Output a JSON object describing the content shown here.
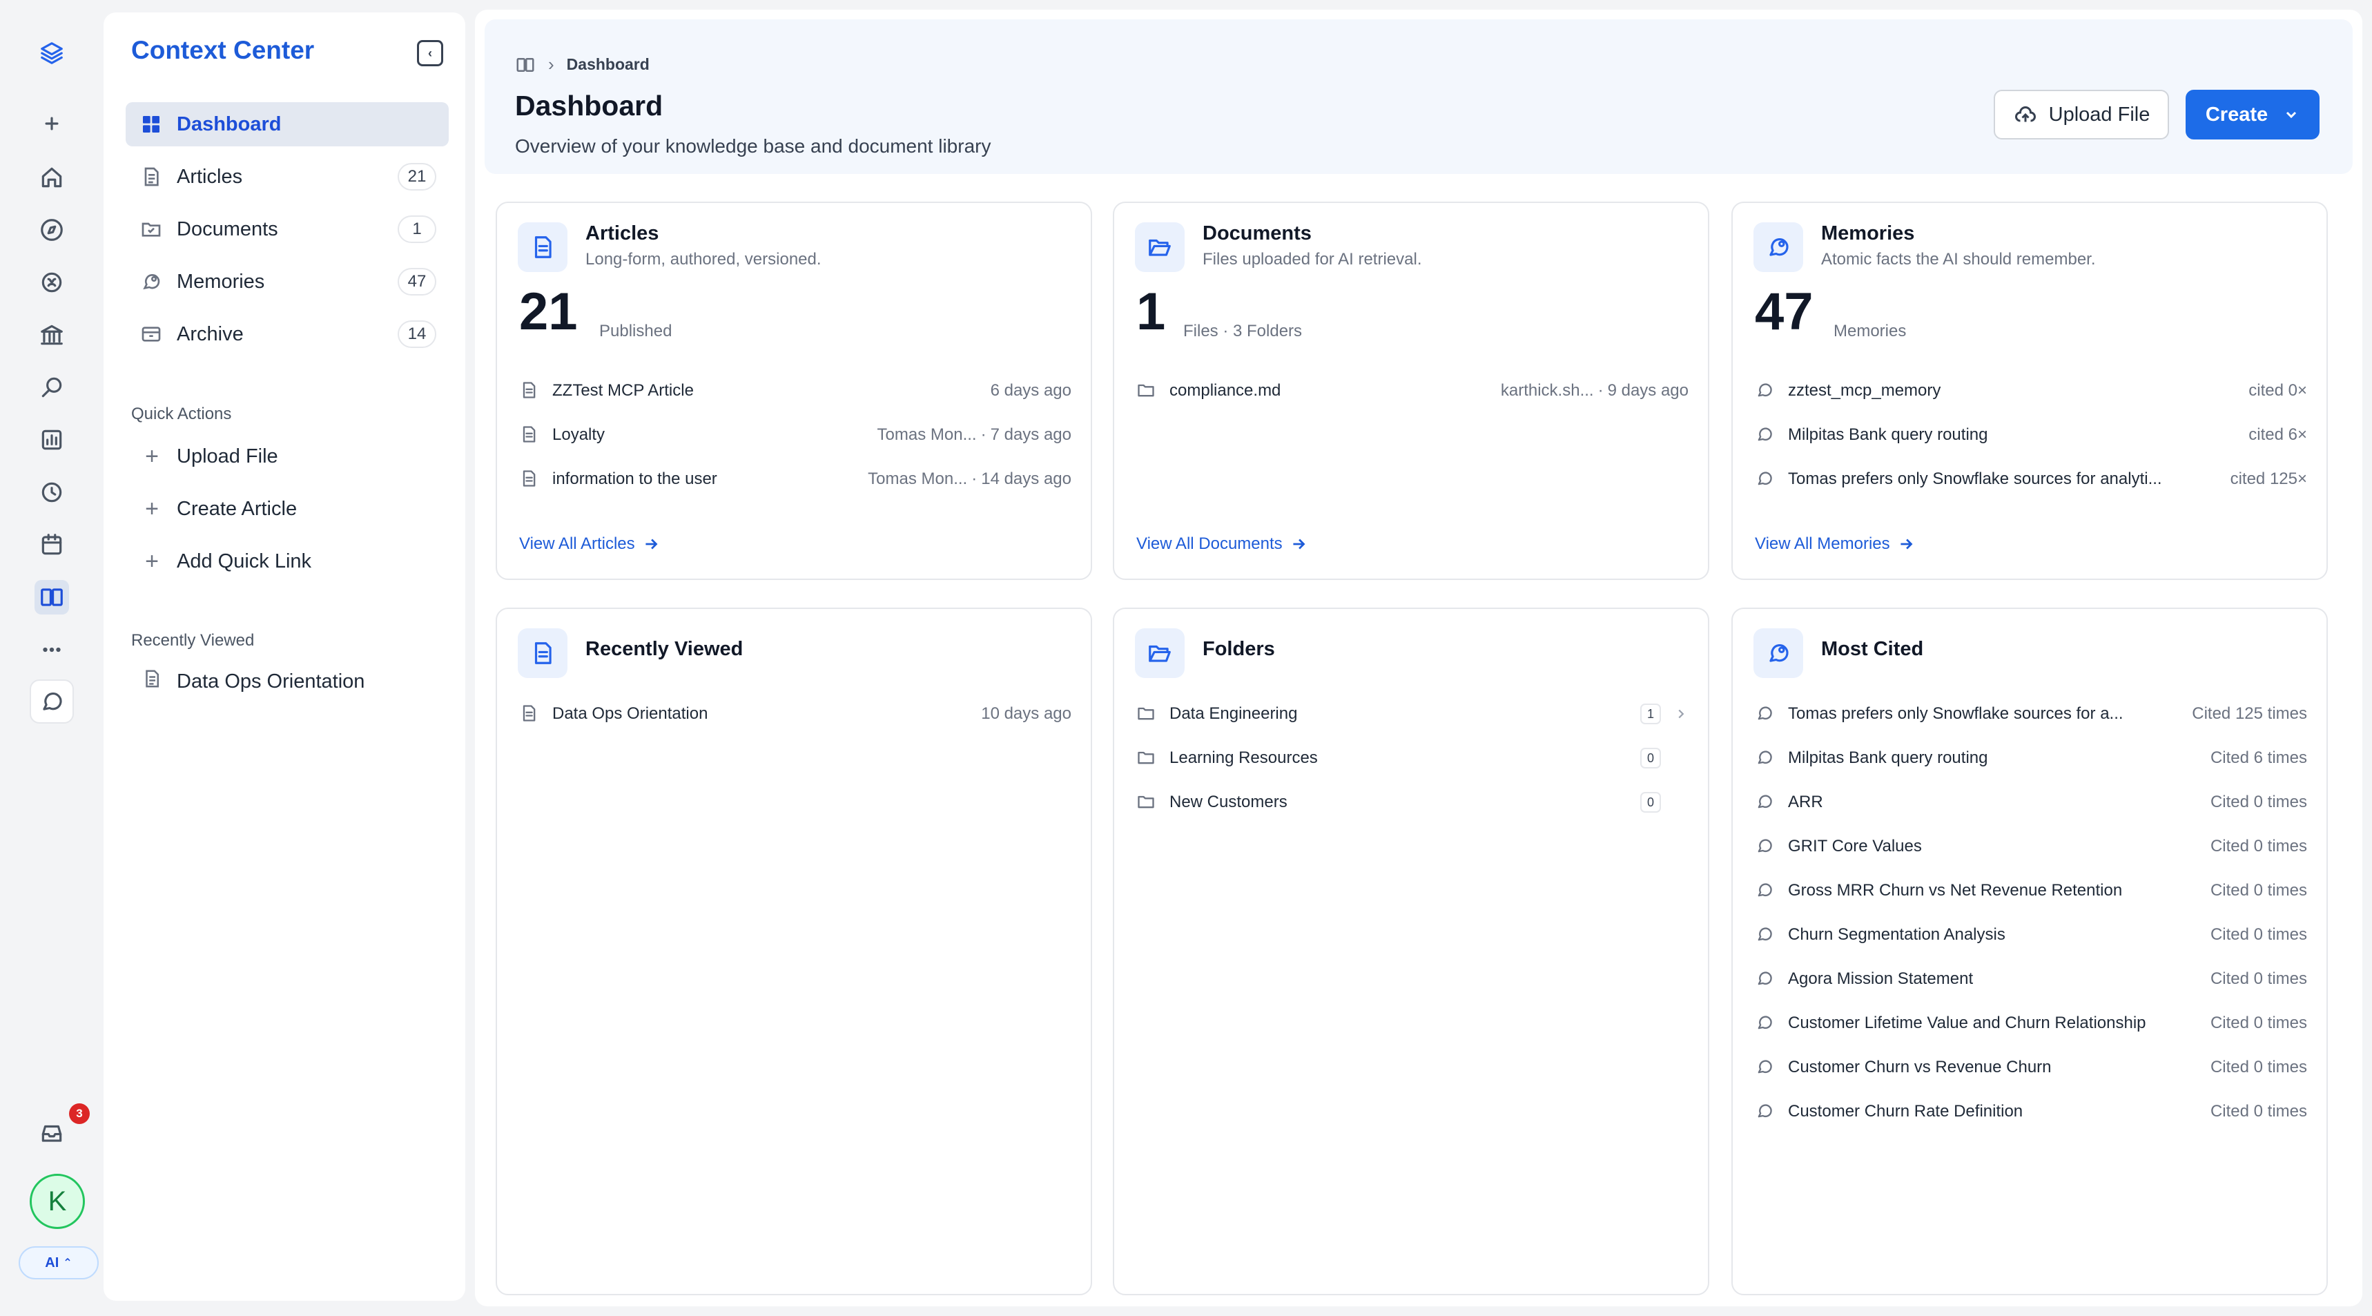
{
  "sidebar": {
    "title": "Context Center",
    "nav": [
      {
        "label": "Dashboard",
        "count": ""
      },
      {
        "label": "Articles",
        "count": "21"
      },
      {
        "label": "Documents",
        "count": "1"
      },
      {
        "label": "Memories",
        "count": "47"
      },
      {
        "label": "Archive",
        "count": "14"
      }
    ],
    "quick_actions_label": "Quick Actions",
    "quick_actions": [
      "Upload File",
      "Create Article",
      "Add Quick Link"
    ],
    "recently_viewed_label": "Recently Viewed",
    "recently_viewed": [
      "Data Ops Orientation"
    ]
  },
  "rail": {
    "notification_count": "3",
    "avatar_initial": "K",
    "ai_label": "AI"
  },
  "header": {
    "breadcrumb": "Dashboard",
    "title": "Dashboard",
    "subtitle": "Overview of your knowledge base and document library",
    "upload_label": "Upload File",
    "create_label": "Create"
  },
  "articles": {
    "title": "Articles",
    "desc": "Long-form, authored, versioned.",
    "count": "21",
    "count_label": "Published",
    "items": [
      {
        "name": "ZZTest MCP Article",
        "author": "",
        "time": "6 days ago"
      },
      {
        "name": "Loyalty",
        "author": "Tomas Mon...",
        "time": "7 days ago"
      },
      {
        "name": "information to the user",
        "author": "Tomas Mon...",
        "time": "14 days ago"
      }
    ],
    "view_all": "View All Articles"
  },
  "documents": {
    "title": "Documents",
    "desc": "Files uploaded for AI retrieval.",
    "count": "1",
    "count_label": "Files · 3 Folders",
    "items": [
      {
        "name": "compliance.md",
        "author": "karthick.sh...",
        "time": "9 days ago"
      }
    ],
    "view_all": "View All Documents"
  },
  "memories": {
    "title": "Memories",
    "desc": "Atomic facts the AI should remember.",
    "count": "47",
    "count_label": "Memories",
    "items": [
      {
        "name": "zztest_mcp_memory",
        "cited": "cited 0×"
      },
      {
        "name": "Milpitas Bank query routing",
        "cited": "cited 6×"
      },
      {
        "name": "Tomas prefers only Snowflake sources for analyti...",
        "cited": "cited 125×"
      }
    ],
    "view_all": "View All Memories"
  },
  "recently_viewed": {
    "title": "Recently Viewed",
    "items": [
      {
        "name": "Data Ops Orientation",
        "time": "10 days ago"
      }
    ]
  },
  "folders": {
    "title": "Folders",
    "items": [
      {
        "name": "Data Engineering",
        "count": "1"
      },
      {
        "name": "Learning Resources",
        "count": "0"
      },
      {
        "name": "New Customers",
        "count": "0"
      }
    ]
  },
  "most_cited": {
    "title": "Most Cited",
    "items": [
      {
        "name": "Tomas prefers only Snowflake sources for a...",
        "cited": "Cited 125 times"
      },
      {
        "name": "Milpitas Bank query routing",
        "cited": "Cited 6 times"
      },
      {
        "name": "ARR",
        "cited": "Cited 0 times"
      },
      {
        "name": "GRIT Core Values",
        "cited": "Cited 0 times"
      },
      {
        "name": "Gross MRR Churn vs Net Revenue Retention",
        "cited": "Cited 0 times"
      },
      {
        "name": "Churn Segmentation Analysis",
        "cited": "Cited 0 times"
      },
      {
        "name": "Agora Mission Statement",
        "cited": "Cited 0 times"
      },
      {
        "name": "Customer Lifetime Value and Churn Relationship",
        "cited": "Cited 0 times"
      },
      {
        "name": "Customer Churn vs Revenue Churn",
        "cited": "Cited 0 times"
      },
      {
        "name": "Customer Churn Rate Definition",
        "cited": "Cited 0 times"
      }
    ]
  },
  "colors": {
    "accent": "#1d6ce8",
    "brand_title": "#1d5bd8",
    "icon_bg": "#eaf1fd",
    "badge": "#dc2626"
  }
}
